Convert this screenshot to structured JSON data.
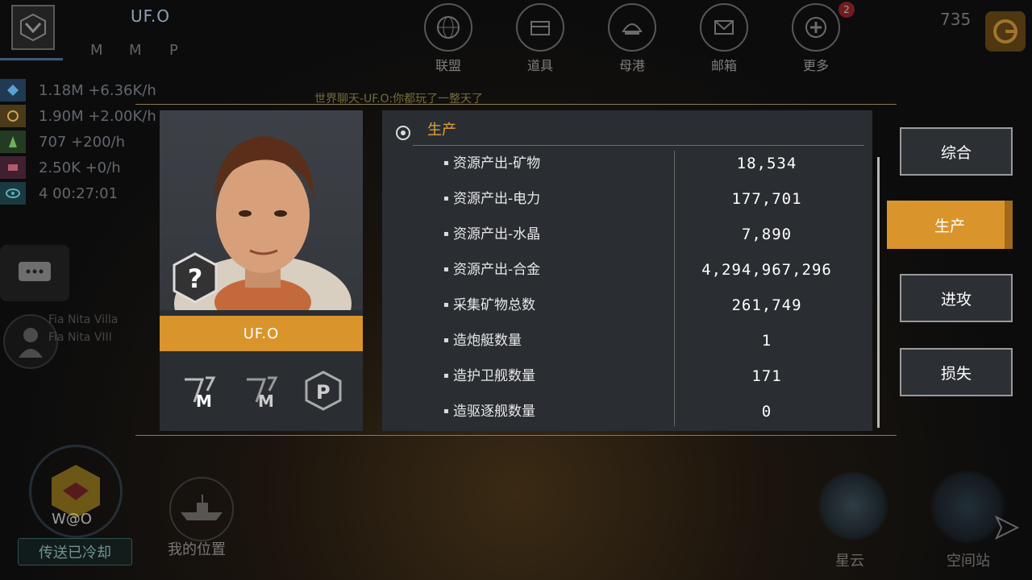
{
  "hud": {
    "player_name": "UF.O",
    "resources": [
      {
        "icon": "mineral-icon",
        "text": "1.18M +6.36K/h",
        "color": "#3d7fb0"
      },
      {
        "icon": "power-icon",
        "text": "1.90M +2.00K/h",
        "color": "#b58a3a"
      },
      {
        "icon": "crystal-icon",
        "text": "707 +200/h",
        "color": "#5f9a4c"
      },
      {
        "icon": "alloy-icon",
        "text": "2.50K +0/h",
        "color": "#a04a5a"
      },
      {
        "icon": "eye-icon",
        "text": "4   00:27:01",
        "color": "#3b8f9c"
      }
    ],
    "menu": [
      {
        "label": "联盟",
        "icon": "alliance-globe-icon"
      },
      {
        "label": "道具",
        "icon": "items-icon"
      },
      {
        "label": "母港",
        "icon": "home-port-icon"
      },
      {
        "label": "邮箱",
        "icon": "mail-icon",
        "badge": "2"
      },
      {
        "label": "更多",
        "icon": "more-plus-icon"
      }
    ],
    "top_right_value": "735",
    "world_chat": "世界聊天-UF.O:你都玩了一整天了",
    "location_lines": [
      "Fia Nita Villa",
      "Fia Nita VIII"
    ],
    "team_tag": "W@O",
    "teleport_label": "传送已冷却",
    "my_position_label": "我的位置",
    "nebula_label": "星云",
    "station_label": "空间站"
  },
  "profile": {
    "name": "UF.O"
  },
  "stats": {
    "section_title": "生产",
    "rows": [
      {
        "label": "资源产出-矿物",
        "value": "18,534"
      },
      {
        "label": "资源产出-电力",
        "value": "177,701"
      },
      {
        "label": "资源产出-水晶",
        "value": "7,890"
      },
      {
        "label": "资源产出-合金",
        "value": "4,294,967,296"
      },
      {
        "label": "采集矿物总数",
        "value": "261,749"
      },
      {
        "label": "造炮艇数量",
        "value": "1"
      },
      {
        "label": "造护卫舰数量",
        "value": "171"
      },
      {
        "label": "造驱逐舰数量",
        "value": "0"
      }
    ]
  },
  "tabs": [
    {
      "label": "综合",
      "active": false
    },
    {
      "label": "生产",
      "active": true
    },
    {
      "label": "进攻",
      "active": false
    },
    {
      "label": "损失",
      "active": false
    }
  ],
  "colors": {
    "accent": "#d9952c",
    "panel": "#2a2e33",
    "title": "#e2a23a"
  }
}
